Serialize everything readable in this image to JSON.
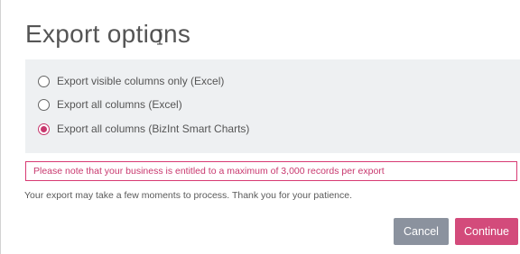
{
  "dialog": {
    "title": "Export options"
  },
  "options": [
    {
      "label": "Export visible columns only (Excel)",
      "checked": false
    },
    {
      "label": "Export all columns (Excel)",
      "checked": false
    },
    {
      "label": "Export all columns (BizInt Smart Charts)",
      "checked": true
    }
  ],
  "notice": "Please note that your business is entitled to a maximum of 3,000 records per export",
  "info": "Your export may take a few moments to process. Thank you for your patience.",
  "buttons": {
    "cancel": "Cancel",
    "continue": "Continue"
  },
  "colors": {
    "accent": "#d34b7b",
    "cancel": "#8b929e",
    "panel": "#eef0f2"
  },
  "icons": {
    "cursor": "text-cursor-icon"
  }
}
